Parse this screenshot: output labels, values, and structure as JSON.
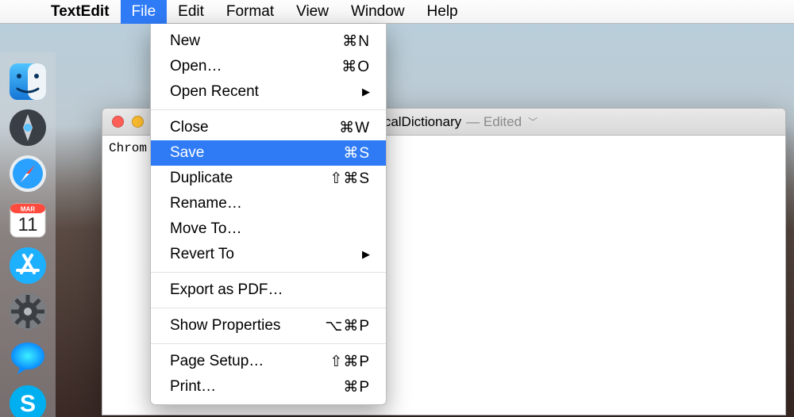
{
  "menubar": {
    "app": "TextEdit",
    "items": [
      "File",
      "Edit",
      "Format",
      "View",
      "Window",
      "Help"
    ],
    "open_index": 0
  },
  "dropdown": {
    "highlighted_index": 4,
    "items": [
      {
        "label": "New",
        "shortcut": "⌘N",
        "kind": "item"
      },
      {
        "label": "Open…",
        "shortcut": "⌘O",
        "kind": "item"
      },
      {
        "label": "Open Recent",
        "submenu": true,
        "kind": "item"
      },
      {
        "kind": "sep"
      },
      {
        "label": "Close",
        "shortcut": "⌘W",
        "kind": "item"
      },
      {
        "label": "Save",
        "shortcut": "⌘S",
        "kind": "item"
      },
      {
        "label": "Duplicate",
        "shortcut": "⇧⌘S",
        "kind": "item"
      },
      {
        "label": "Rename…",
        "kind": "item"
      },
      {
        "label": "Move To…",
        "kind": "item"
      },
      {
        "label": "Revert To",
        "submenu": true,
        "kind": "item"
      },
      {
        "kind": "sep"
      },
      {
        "label": "Export as PDF…",
        "kind": "item"
      },
      {
        "kind": "sep"
      },
      {
        "label": "Show Properties",
        "shortcut": "⌥⌘P",
        "kind": "item"
      },
      {
        "kind": "sep"
      },
      {
        "label": "Page Setup…",
        "shortcut": "⇧⌘P",
        "kind": "item"
      },
      {
        "label": "Print…",
        "shortcut": "⌘P",
        "kind": "item"
      }
    ]
  },
  "window": {
    "title": "LocalDictionary",
    "subtitle": " — Edited",
    "content_line1": "Chrom"
  },
  "dock": {
    "items": [
      {
        "id": "finder",
        "name": "finder-icon"
      },
      {
        "id": "launchpad",
        "name": "launchpad-icon"
      },
      {
        "id": "safari",
        "name": "safari-icon"
      },
      {
        "id": "calendar",
        "name": "calendar-icon",
        "badge": "11",
        "month": "MAR"
      },
      {
        "id": "appstore",
        "name": "appstore-icon"
      },
      {
        "id": "settings",
        "name": "settings-icon"
      },
      {
        "id": "messages",
        "name": "messages-icon"
      },
      {
        "id": "skype",
        "name": "skype-icon",
        "letter": "S"
      }
    ]
  },
  "colors": {
    "highlight": "#2f7bf6"
  }
}
